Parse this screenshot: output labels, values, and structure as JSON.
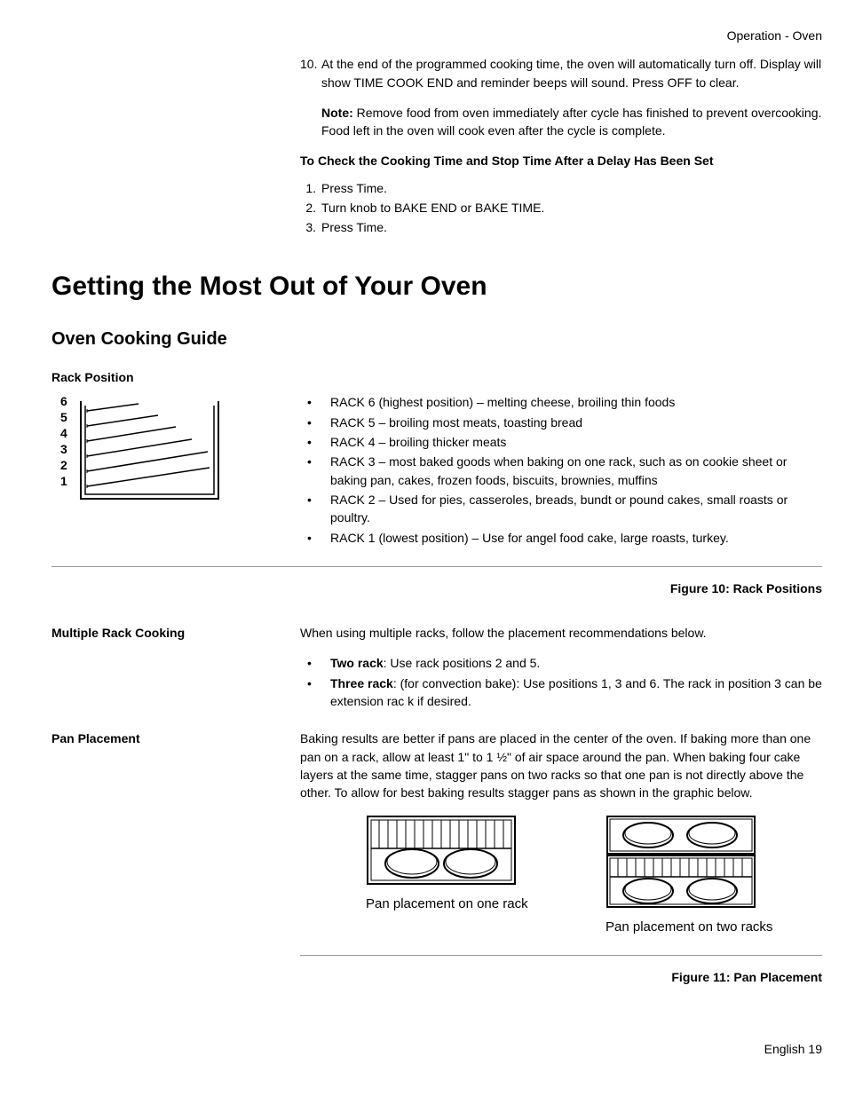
{
  "header": {
    "breadcrumb": "Operation - Oven"
  },
  "step10": {
    "num": "10.",
    "text": "At the end of the programmed cooking time, the oven will automatically turn off. Display will show TIME COOK END and reminder beeps will sound. Press OFF to clear.",
    "note_label": "Note:",
    "note_text": " Remove food from oven immediately after cycle has finished to prevent overcooking. Food left in the oven will cook even after the cycle is complete."
  },
  "check_heading": "To Check the Cooking Time and Stop Time After a Delay Has Been Set",
  "check_steps": [
    {
      "n": "1.",
      "t": "Press Time."
    },
    {
      "n": "2.",
      "t": "Turn knob to BAKE END or BAKE TIME."
    },
    {
      "n": "3.",
      "t": "Press Time."
    }
  ],
  "h1": "Getting the Most Out of Your Oven",
  "h2": "Oven Cooking Guide",
  "rack_position_heading": "Rack Position",
  "rack_labels": [
    "6",
    "5",
    "4",
    "3",
    "2",
    "1"
  ],
  "rack_bullets": [
    "RACK 6 (highest position) –  melting cheese, broiling thin foods",
    "RACK 5 –  broiling most meats, toasting bread",
    "RACK 4 –  broiling thicker meats",
    "RACK 3 –  most baked goods when baking on one rack, such as on cookie sheet or baking pan, cakes, frozen foods, biscuits, brownies, muffins",
    "RACK 2 – Used for pies, casseroles, breads, bundt or pound cakes, small roasts or poultry.",
    "RACK 1 (lowest position) – Use for angel food cake, large roasts, turkey."
  ],
  "figure10": "Figure 10: Rack Positions",
  "multiple_rack": {
    "label": "Multiple Rack Cooking",
    "intro": "When using multiple racks, follow the placement recommendations below.",
    "two_rack_label": "Two rack",
    "two_rack_text": ": Use rack positions 2 and 5.",
    "three_rack_label": "Three rack",
    "three_rack_text": ": (for convection bake): Use positions 1, 3 and 6. The rack in position 3 can be extension rac k if desired."
  },
  "pan_placement": {
    "label": "Pan Placement",
    "text": "Baking results are better if pans are placed in the center of the oven. If baking more than one pan on a rack, allow at least 1\" to 1 ½\" of air space around the pan. When baking four cake layers at the same time, stagger pans on two racks so that one pan is not directly above the other. To allow for best baking results stagger pans as shown in the graphic below.",
    "caption1": "Pan placement on one rack",
    "caption2": "Pan placement on two racks"
  },
  "figure11": "Figure 11: Pan Placement",
  "footer": "English 19"
}
